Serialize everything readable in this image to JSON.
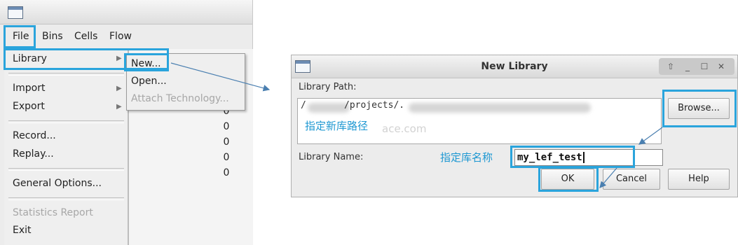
{
  "left_window": {
    "menubar": [
      "File",
      "Bins",
      "Cells",
      "Flow"
    ],
    "file_menu": {
      "library": "Library",
      "import": "Import",
      "export": "Export",
      "record": "Record...",
      "replay": "Replay...",
      "general_options": "General Options...",
      "statistics_report": "Statistics Report",
      "exit": "Exit"
    },
    "library_submenu": {
      "new": "New...",
      "open": "Open...",
      "attach_technology": "Attach Technology..."
    },
    "background_values": [
      "0",
      "0",
      "0",
      "0",
      "0"
    ]
  },
  "dialog": {
    "title": "New Library",
    "library_path_label": "Library Path:",
    "library_path_value_start": "/",
    "library_path_value_mid": "/projects/.",
    "browse_label": "Browse...",
    "library_name_label": "Library Name:",
    "library_name_value": "my_lef_test",
    "ok_label": "OK",
    "cancel_label": "Cancel",
    "help_label": "Help"
  },
  "annotations": {
    "path_hint": "指定新库路径",
    "name_hint": "指定库名称",
    "watermark": "ace.com"
  },
  "colors": {
    "highlight": "#2aa4dc",
    "annotation_text": "#1e98d2",
    "arrow": "#4a7fb0"
  },
  "icons": {
    "window_icon": "window-icon",
    "submenu_arrow": "triangle-right",
    "wm_up": "arrow-up-icon",
    "wm_min": "minimize-icon",
    "wm_max": "maximize-icon",
    "wm_close": "close-icon"
  }
}
